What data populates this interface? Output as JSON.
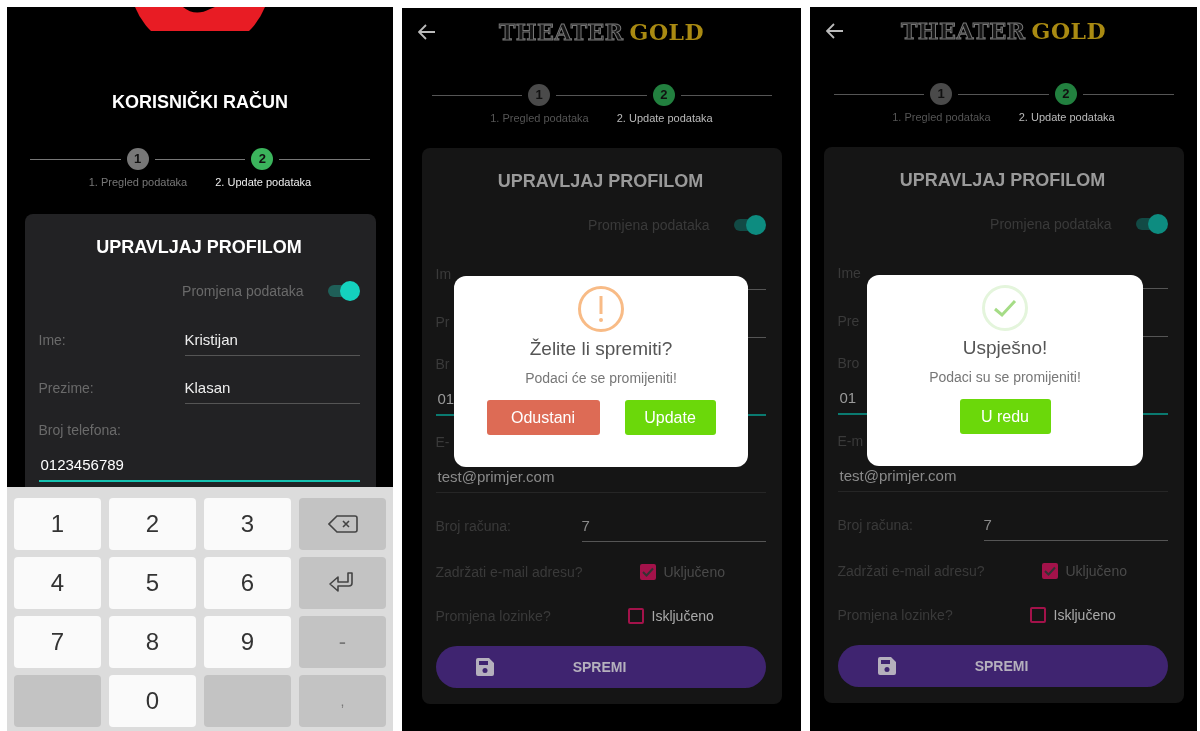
{
  "screens": [
    {
      "kind": "keyboard",
      "dimmed": false,
      "title": "KORISNIČKI RAČUN",
      "steps": [
        {
          "number": "1",
          "label": "1. Pregled podataka",
          "selected": false
        },
        {
          "number": "2",
          "label": "2. Update podataka",
          "selected": true
        }
      ],
      "card": {
        "title": "UPRAVLJAJ PROFILOM",
        "toggle": {
          "label": "Promjena podataka",
          "on": true
        },
        "fields": [
          {
            "kind": "inline",
            "label": "Ime:",
            "value": "Kristijan"
          },
          {
            "kind": "inline",
            "label": "Prezime:",
            "value": "Klasan"
          },
          {
            "kind": "stacked",
            "label": "Broj telefona:",
            "value": "0123456789",
            "focused": true
          }
        ]
      },
      "keyboard": {
        "keys": [
          {
            "kind": "digit",
            "label": "1"
          },
          {
            "kind": "digit",
            "label": "2"
          },
          {
            "kind": "digit",
            "label": "3"
          },
          {
            "kind": "backspace"
          },
          {
            "kind": "digit",
            "label": "4"
          },
          {
            "kind": "digit",
            "label": "5"
          },
          {
            "kind": "digit",
            "label": "6"
          },
          {
            "kind": "enter"
          },
          {
            "kind": "digit",
            "label": "7"
          },
          {
            "kind": "digit",
            "label": "8"
          },
          {
            "kind": "digit",
            "label": "9"
          },
          {
            "kind": "function",
            "label": "-"
          },
          {
            "kind": "blank"
          },
          {
            "kind": "digit",
            "label": "0"
          },
          {
            "kind": "blank"
          },
          {
            "kind": "function",
            "label": ","
          }
        ]
      }
    },
    {
      "kind": "dialog",
      "dimmed": true,
      "logo": {
        "outline": "THEATER",
        "gold": "GOLD"
      },
      "steps": [
        {
          "number": "1",
          "label": "1. Pregled podataka",
          "selected": false
        },
        {
          "number": "2",
          "label": "2. Update podataka",
          "selected": true
        }
      ],
      "card": {
        "title": "UPRAVLJAJ PROFILOM",
        "toggle": {
          "label": "Promjena podataka",
          "on": true
        },
        "fields": [
          {
            "kind": "inline",
            "label": "Im"
          },
          {
            "kind": "inline",
            "label": "Pr"
          },
          {
            "kind": "stacked",
            "label": "Br",
            "value": "01",
            "focused": true
          },
          {
            "kind": "stacked",
            "label": "E-",
            "value": "test@primjer.com",
            "focused": false
          },
          {
            "kind": "inline",
            "label": "Broj računa:",
            "value": "7"
          }
        ],
        "checks": [
          {
            "label": "Zadržati e-mail adresu?",
            "caption": "Uključeno",
            "checked": true
          },
          {
            "label": "Promjena lozinke?",
            "caption": "Isključeno",
            "checked": false
          }
        ],
        "save_button": "SPREMI"
      },
      "dialog": {
        "kind": "warning",
        "title": "Želite li spremiti?",
        "message": "Podaci će se promijeniti!",
        "buttons": [
          {
            "kind": "cancel",
            "label": "Odustani"
          },
          {
            "kind": "confirm",
            "label": "Update"
          }
        ]
      }
    },
    {
      "kind": "dialog",
      "dimmed": true,
      "logo": {
        "outline": "THEATER",
        "gold": "GOLD"
      },
      "steps": [
        {
          "number": "1",
          "label": "1. Pregled podataka",
          "selected": false
        },
        {
          "number": "2",
          "label": "2. Update podataka",
          "selected": true
        }
      ],
      "card": {
        "title": "UPRAVLJAJ PROFILOM",
        "toggle": {
          "label": "Promjena podataka",
          "on": true
        },
        "fields": [
          {
            "kind": "inline",
            "label": "Ime"
          },
          {
            "kind": "inline",
            "label": "Pre"
          },
          {
            "kind": "stacked",
            "label": "Bro",
            "value": "01",
            "focused": true
          },
          {
            "kind": "stacked",
            "label": "E-m",
            "value": "test@primjer.com",
            "focused": false
          },
          {
            "kind": "inline",
            "label": "Broj računa:",
            "value": "7"
          }
        ],
        "checks": [
          {
            "label": "Zadržati e-mail adresu?",
            "caption": "Uključeno",
            "checked": true
          },
          {
            "label": "Promjena lozinke?",
            "caption": "Isključeno",
            "checked": false
          }
        ],
        "save_button": "SPREMI"
      },
      "dialog": {
        "kind": "success",
        "title": "Uspješno!",
        "message": "Podaci su se promijeniti!",
        "buttons": [
          {
            "kind": "confirm",
            "label": "U redu"
          }
        ]
      }
    }
  ]
}
